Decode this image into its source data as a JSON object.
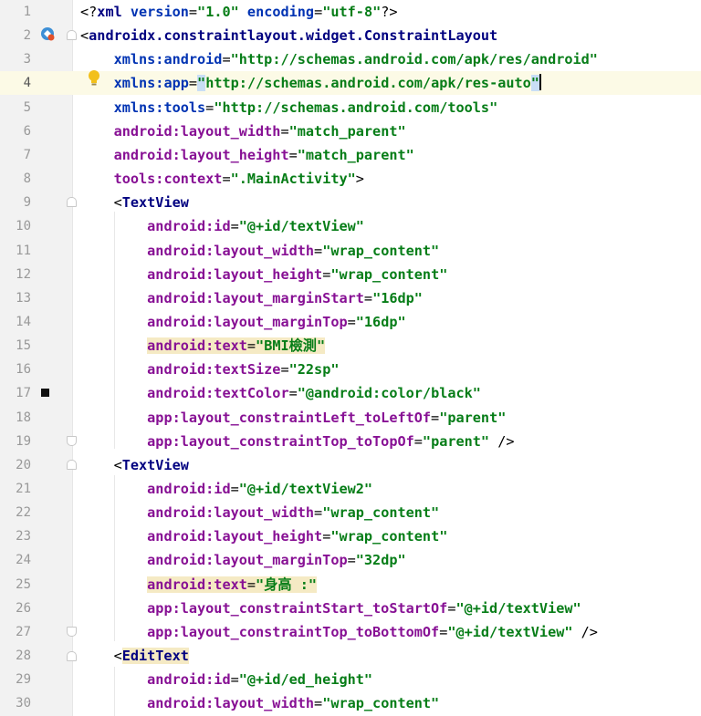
{
  "editor": {
    "language": "XML",
    "active_line": 4,
    "lines": [
      {
        "n": "1",
        "tokens": [
          [
            "punc",
            "<?"
          ],
          [
            "tag",
            "xml "
          ],
          [
            "ns",
            "version"
          ],
          [
            "punc",
            "="
          ],
          [
            "str",
            "\"1.0\""
          ],
          [
            "punc",
            " "
          ],
          [
            "ns",
            "encoding"
          ],
          [
            "punc",
            "="
          ],
          [
            "str",
            "\"utf-8\""
          ],
          [
            "punc",
            "?>"
          ]
        ]
      },
      {
        "n": "2",
        "tokens": [
          [
            "punc",
            "<"
          ],
          [
            "tag",
            "androidx.constraintlayout.widget.ConstraintLayout"
          ]
        ]
      },
      {
        "n": "3",
        "tokens": [
          [
            "punc",
            "    "
          ],
          [
            "ns",
            "xmlns:android"
          ],
          [
            "punc",
            "="
          ],
          [
            "str",
            "\"http://schemas.android.com/apk/res/android\""
          ]
        ]
      },
      {
        "n": "4",
        "tokens": [
          [
            "punc",
            "    "
          ],
          [
            "ns",
            "xmlns:app"
          ],
          [
            "punc",
            "="
          ],
          [
            "sel",
            "\""
          ],
          [
            "str",
            "http://schemas.android.com/apk/res-auto"
          ],
          [
            "sel",
            "\""
          ],
          [
            "caret",
            ""
          ]
        ]
      },
      {
        "n": "5",
        "tokens": [
          [
            "punc",
            "    "
          ],
          [
            "ns",
            "xmlns:tools"
          ],
          [
            "punc",
            "="
          ],
          [
            "str",
            "\"http://schemas.android.com/tools\""
          ]
        ]
      },
      {
        "n": "6",
        "tokens": [
          [
            "punc",
            "    "
          ],
          [
            "attr",
            "android:layout_width"
          ],
          [
            "punc",
            "="
          ],
          [
            "str",
            "\"match_parent\""
          ]
        ]
      },
      {
        "n": "7",
        "tokens": [
          [
            "punc",
            "    "
          ],
          [
            "attr",
            "android:layout_height"
          ],
          [
            "punc",
            "="
          ],
          [
            "str",
            "\"match_parent\""
          ]
        ]
      },
      {
        "n": "8",
        "tokens": [
          [
            "punc",
            "    "
          ],
          [
            "attr",
            "tools:context"
          ],
          [
            "punc",
            "="
          ],
          [
            "str",
            "\".MainActivity\""
          ],
          [
            "punc",
            ">"
          ]
        ]
      },
      {
        "n": "9",
        "tokens": [
          [
            "punc",
            "    <"
          ],
          [
            "tag",
            "TextView"
          ]
        ]
      },
      {
        "n": "10",
        "tokens": [
          [
            "punc",
            "        "
          ],
          [
            "attr",
            "android:id"
          ],
          [
            "punc",
            "="
          ],
          [
            "str",
            "\"@+id/textView\""
          ]
        ]
      },
      {
        "n": "11",
        "tokens": [
          [
            "punc",
            "        "
          ],
          [
            "attr",
            "android:layout_width"
          ],
          [
            "punc",
            "="
          ],
          [
            "str",
            "\"wrap_content\""
          ]
        ]
      },
      {
        "n": "12",
        "tokens": [
          [
            "punc",
            "        "
          ],
          [
            "attr",
            "android:layout_height"
          ],
          [
            "punc",
            "="
          ],
          [
            "str",
            "\"wrap_content\""
          ]
        ]
      },
      {
        "n": "13",
        "tokens": [
          [
            "punc",
            "        "
          ],
          [
            "attr",
            "android:layout_marginStart"
          ],
          [
            "punc",
            "="
          ],
          [
            "str",
            "\"16dp\""
          ]
        ]
      },
      {
        "n": "14",
        "tokens": [
          [
            "punc",
            "        "
          ],
          [
            "attr",
            "android:layout_marginTop"
          ],
          [
            "punc",
            "="
          ],
          [
            "str",
            "\"16dp\""
          ]
        ]
      },
      {
        "n": "15",
        "tokens": [
          [
            "punc",
            "        "
          ],
          [
            "hlattr",
            "android:text"
          ],
          [
            "hlpunc",
            "="
          ],
          [
            "hlstr",
            "\"BMI檢測\""
          ]
        ]
      },
      {
        "n": "16",
        "tokens": [
          [
            "punc",
            "        "
          ],
          [
            "attr",
            "android:textSize"
          ],
          [
            "punc",
            "="
          ],
          [
            "str",
            "\"22sp\""
          ]
        ]
      },
      {
        "n": "17",
        "tokens": [
          [
            "punc",
            "        "
          ],
          [
            "attr",
            "android:textColor"
          ],
          [
            "punc",
            "="
          ],
          [
            "str",
            "\"@android:color/black\""
          ]
        ]
      },
      {
        "n": "18",
        "tokens": [
          [
            "punc",
            "        "
          ],
          [
            "attr",
            "app:layout_constraintLeft_toLeftOf"
          ],
          [
            "punc",
            "="
          ],
          [
            "str",
            "\"parent\""
          ]
        ]
      },
      {
        "n": "19",
        "tokens": [
          [
            "punc",
            "        "
          ],
          [
            "attr",
            "app:layout_constraintTop_toTopOf"
          ],
          [
            "punc",
            "="
          ],
          [
            "str",
            "\"parent\""
          ],
          [
            "punc",
            " />"
          ]
        ]
      },
      {
        "n": "20",
        "tokens": [
          [
            "punc",
            "    <"
          ],
          [
            "tag",
            "TextView"
          ]
        ]
      },
      {
        "n": "21",
        "tokens": [
          [
            "punc",
            "        "
          ],
          [
            "attr",
            "android:id"
          ],
          [
            "punc",
            "="
          ],
          [
            "str",
            "\"@+id/textView2\""
          ]
        ]
      },
      {
        "n": "22",
        "tokens": [
          [
            "punc",
            "        "
          ],
          [
            "attr",
            "android:layout_width"
          ],
          [
            "punc",
            "="
          ],
          [
            "str",
            "\"wrap_content\""
          ]
        ]
      },
      {
        "n": "23",
        "tokens": [
          [
            "punc",
            "        "
          ],
          [
            "attr",
            "android:layout_height"
          ],
          [
            "punc",
            "="
          ],
          [
            "str",
            "\"wrap_content\""
          ]
        ]
      },
      {
        "n": "24",
        "tokens": [
          [
            "punc",
            "        "
          ],
          [
            "attr",
            "android:layout_marginTop"
          ],
          [
            "punc",
            "="
          ],
          [
            "str",
            "\"32dp\""
          ]
        ]
      },
      {
        "n": "25",
        "tokens": [
          [
            "punc",
            "        "
          ],
          [
            "hlattr",
            "android:text"
          ],
          [
            "hlpunc",
            "="
          ],
          [
            "hlstr",
            "\"身高 :\""
          ]
        ]
      },
      {
        "n": "26",
        "tokens": [
          [
            "punc",
            "        "
          ],
          [
            "attr",
            "app:layout_constraintStart_toStartOf"
          ],
          [
            "punc",
            "="
          ],
          [
            "str",
            "\"@+id/textView\""
          ]
        ]
      },
      {
        "n": "27",
        "tokens": [
          [
            "punc",
            "        "
          ],
          [
            "attr",
            "app:layout_constraintTop_toBottomOf"
          ],
          [
            "punc",
            "="
          ],
          [
            "str",
            "\"@+id/textView\""
          ],
          [
            "punc",
            " />"
          ]
        ]
      },
      {
        "n": "28",
        "tokens": [
          [
            "punc",
            "    <"
          ],
          [
            "hltag",
            "EditText"
          ]
        ]
      },
      {
        "n": "29",
        "tokens": [
          [
            "punc",
            "        "
          ],
          [
            "attr",
            "android:id"
          ],
          [
            "punc",
            "="
          ],
          [
            "str",
            "\"@+id/ed_height\""
          ]
        ]
      },
      {
        "n": "30",
        "tokens": [
          [
            "punc",
            "        "
          ],
          [
            "attr",
            "android:layout_width"
          ],
          [
            "punc",
            "="
          ],
          [
            "str",
            "\"wrap_content\""
          ]
        ]
      }
    ]
  },
  "gutter_icons": {
    "line_2": "android-preview-icon",
    "line_4": "intention-bulb-icon",
    "line_17": "color-swatch-icon"
  },
  "colors": {
    "attribute": "#871094",
    "namespace": "#0033b3",
    "string": "#067d17",
    "tag": "#000080",
    "highlight": "#f5eac4",
    "active_line": "#fcfae6"
  }
}
